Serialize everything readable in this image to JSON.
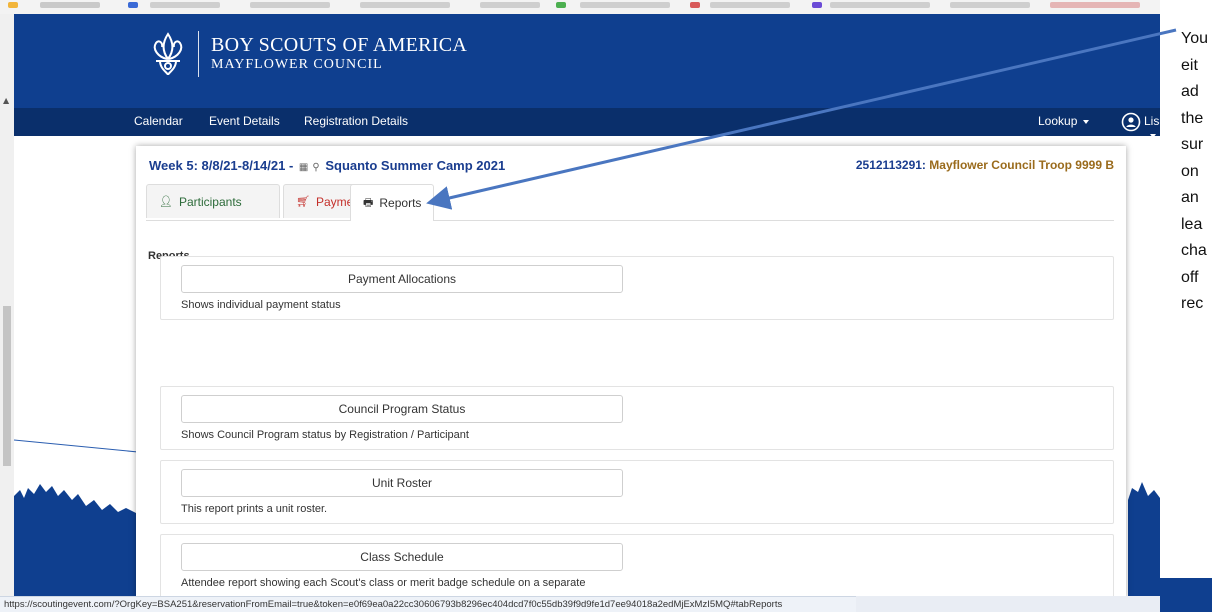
{
  "header": {
    "org_name": "BOY SCOUTS OF AMERICA",
    "council_name": "MAYFLOWER COUNCIL",
    "logo_icon": "fleur-de-lis-icon"
  },
  "nav": {
    "items": [
      "Calendar",
      "Event Details",
      "Registration Details"
    ],
    "lookup_label": "Lookup",
    "user_label": "Lisa"
  },
  "event": {
    "title_prefix": "Week 5: 8/8/21-8/14/21 -",
    "title_name": "Squanto Summer Camp 2021",
    "troop_number": "2512113291:",
    "troop_name": "Mayflower Council Troop 9999 B"
  },
  "tabs": [
    {
      "label": "Participants",
      "icon": "user-icon",
      "color": "#2d6b3a"
    },
    {
      "label": "Payment",
      "icon": "cart-icon",
      "color": "#c4302b"
    },
    {
      "label": "Reports",
      "icon": "print-icon",
      "color": "#333333"
    }
  ],
  "reports_label": "Reports",
  "reports": [
    {
      "button": "Payment Allocations",
      "description": "Shows individual payment status"
    },
    {
      "button": "Council Program Status",
      "description": "Shows Council Program status by Registration / Participant"
    },
    {
      "button": "Unit Roster",
      "description": "This report prints a unit roster."
    },
    {
      "button": "Class Schedule",
      "description": "Attendee report showing each Scout's class or merit badge schedule on a separate"
    }
  ],
  "status_bar": {
    "url": "https://scoutingevent.com/?OrgKey=BSA251&reservationFromEmail=true&token=e0f69ea0a22cc30606793b8296ec404dcd7f0c55db39f9d9fe1d7ee94018a2edMjExMzI5MQ#tabReports"
  },
  "annotation": {
    "lines": [
      "You",
      "eit",
      "ad",
      "the",
      "sur",
      "on",
      "an",
      "lea",
      "cha",
      "off",
      "rec"
    ]
  },
  "colors": {
    "header_blue": "#0f3f8f",
    "nav_blue": "#0a2f6b",
    "title_blue": "#1a3d8f",
    "troop_gold": "#9a6b1c"
  }
}
